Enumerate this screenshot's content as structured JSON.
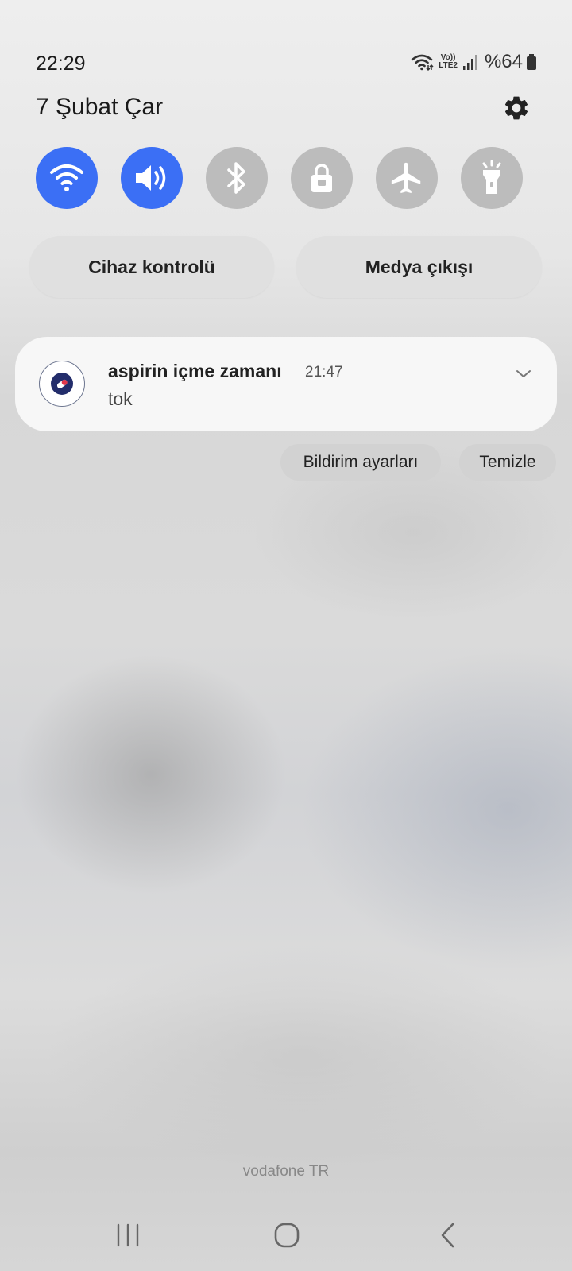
{
  "status_bar": {
    "time": "22:29",
    "volte_top": "Vo))",
    "volte_bottom": "LTE2",
    "battery_text": "%64"
  },
  "header": {
    "date": "7 Şubat Çar"
  },
  "quick_toggles": [
    {
      "name": "wifi",
      "state": "on",
      "icon": "wifi-icon"
    },
    {
      "name": "sound",
      "state": "on",
      "icon": "sound-icon"
    },
    {
      "name": "bluetooth",
      "state": "off",
      "icon": "bluetooth-icon"
    },
    {
      "name": "screen-lock",
      "state": "off",
      "icon": "lock-icon"
    },
    {
      "name": "airplane-mode",
      "state": "off",
      "icon": "airplane-icon"
    },
    {
      "name": "flashlight",
      "state": "off",
      "icon": "flashlight-icon"
    }
  ],
  "pills": {
    "device_control": "Cihaz kontrolü",
    "media_output": "Medya çıkışı"
  },
  "notification": {
    "title": "aspirin içme zamanı",
    "time": "21:47",
    "body": "tok"
  },
  "actions": {
    "notification_settings": "Bildirim ayarları",
    "clear": "Temizle"
  },
  "carrier": "vodafone TR",
  "colors": {
    "toggle_on": "#3b6ff5",
    "toggle_off": "#bcbcbc",
    "card_bg": "#f7f7f7"
  }
}
